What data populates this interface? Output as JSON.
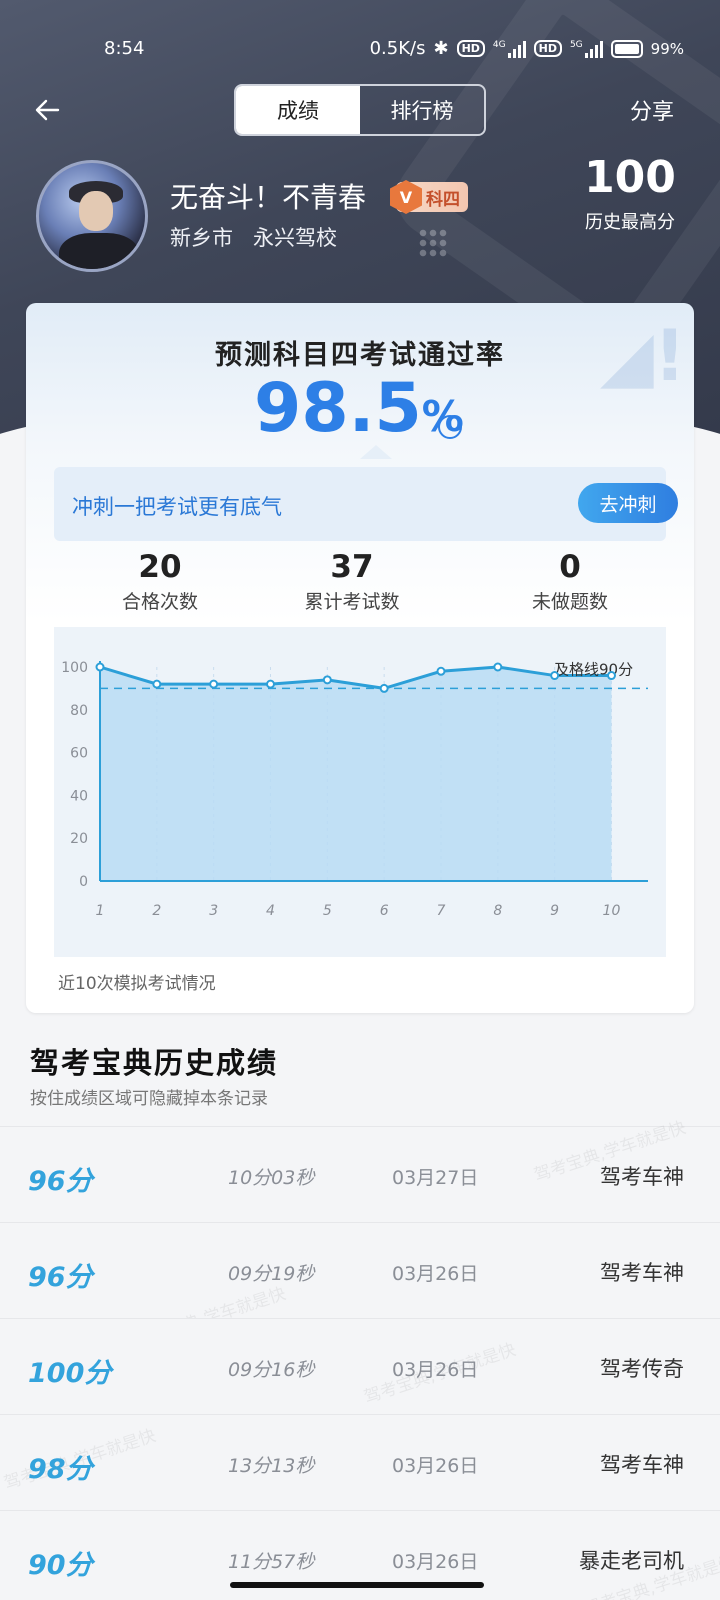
{
  "status_bar": {
    "time": "8:54",
    "net_speed": "0.5K/s",
    "hd1": "HD",
    "net1": "4G",
    "hd2": "HD",
    "net2": "5G",
    "battery": "99%"
  },
  "header": {
    "tabs": [
      {
        "label": "成绩",
        "active": true
      },
      {
        "label": "排行榜",
        "active": false
      }
    ],
    "share_label": "分享"
  },
  "profile": {
    "name": "无奋斗！不青春",
    "badge": "科四",
    "badge_icon": "V",
    "city": "新乡市",
    "school": "永兴驾校",
    "best_score": "100",
    "best_label": "历史最高分"
  },
  "prediction": {
    "title": "预测科目四考试通过率",
    "rate": "98.5",
    "rate_unit": "%",
    "sprint_text": "冲刺一把考试更有底气",
    "sprint_button": "去冲刺"
  },
  "stats": [
    {
      "value": "20",
      "label": "合格次数"
    },
    {
      "value": "37",
      "label": "累计考试数"
    },
    {
      "value": "0",
      "label": "未做题数"
    }
  ],
  "chart_data": {
    "type": "area",
    "x": [
      1,
      2,
      3,
      4,
      5,
      6,
      7,
      8,
      9,
      10
    ],
    "y": [
      100,
      92,
      92,
      92,
      94,
      90,
      98,
      100,
      96,
      96
    ],
    "ylim": [
      0,
      100
    ],
    "yticks": [
      0,
      20,
      40,
      60,
      80,
      100
    ],
    "threshold": {
      "value": 90,
      "label": "及格线90分"
    },
    "caption": "近10次模拟考试情况",
    "line_color": "#2c9fd8",
    "fill_color": "#b9dcf4"
  },
  "history": {
    "title": "驾考宝典历史成绩",
    "subtitle": "按住成绩区域可隐藏掉本条记录",
    "rows": [
      {
        "score": "96分",
        "duration": "10分03秒",
        "date": "03月27日",
        "title": "驾考车神"
      },
      {
        "score": "96分",
        "duration": "09分19秒",
        "date": "03月26日",
        "title": "驾考车神"
      },
      {
        "score": "100分",
        "duration": "09分16秒",
        "date": "03月26日",
        "title": "驾考传奇"
      },
      {
        "score": "98分",
        "duration": "13分13秒",
        "date": "03月26日",
        "title": "驾考车神"
      },
      {
        "score": "90分",
        "duration": "11分57秒",
        "date": "03月26日",
        "title": "暴走老司机"
      }
    ],
    "watermark": "驾考宝典,学车就是快"
  }
}
